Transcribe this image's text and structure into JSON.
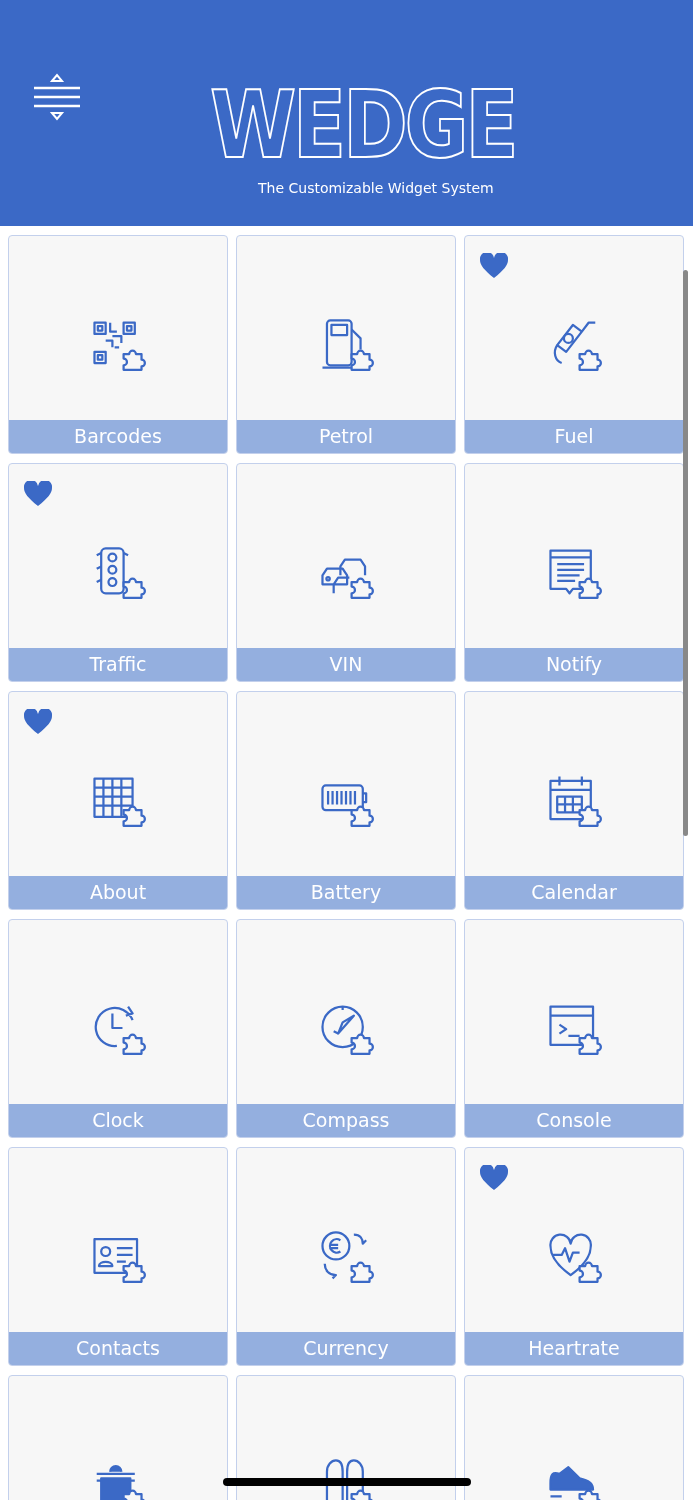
{
  "header": {
    "logo": "WEDGE",
    "tagline": "The Customizable Widget System"
  },
  "tiles": [
    {
      "label": "Barcodes",
      "favorite": false
    },
    {
      "label": "Petrol",
      "favorite": false
    },
    {
      "label": "Fuel",
      "favorite": true
    },
    {
      "label": "Traffic",
      "favorite": true
    },
    {
      "label": "VIN",
      "favorite": false
    },
    {
      "label": "Notify",
      "favorite": false
    },
    {
      "label": "About",
      "favorite": true
    },
    {
      "label": "Battery",
      "favorite": false
    },
    {
      "label": "Calendar",
      "favorite": false
    },
    {
      "label": "Clock",
      "favorite": false
    },
    {
      "label": "Compass",
      "favorite": false
    },
    {
      "label": "Console",
      "favorite": false
    },
    {
      "label": "Contacts",
      "favorite": false
    },
    {
      "label": "Currency",
      "favorite": false
    },
    {
      "label": "Heartrate",
      "favorite": true
    },
    {
      "favorite": false
    },
    {
      "favorite": false
    },
    {
      "favorite": false
    }
  ]
}
